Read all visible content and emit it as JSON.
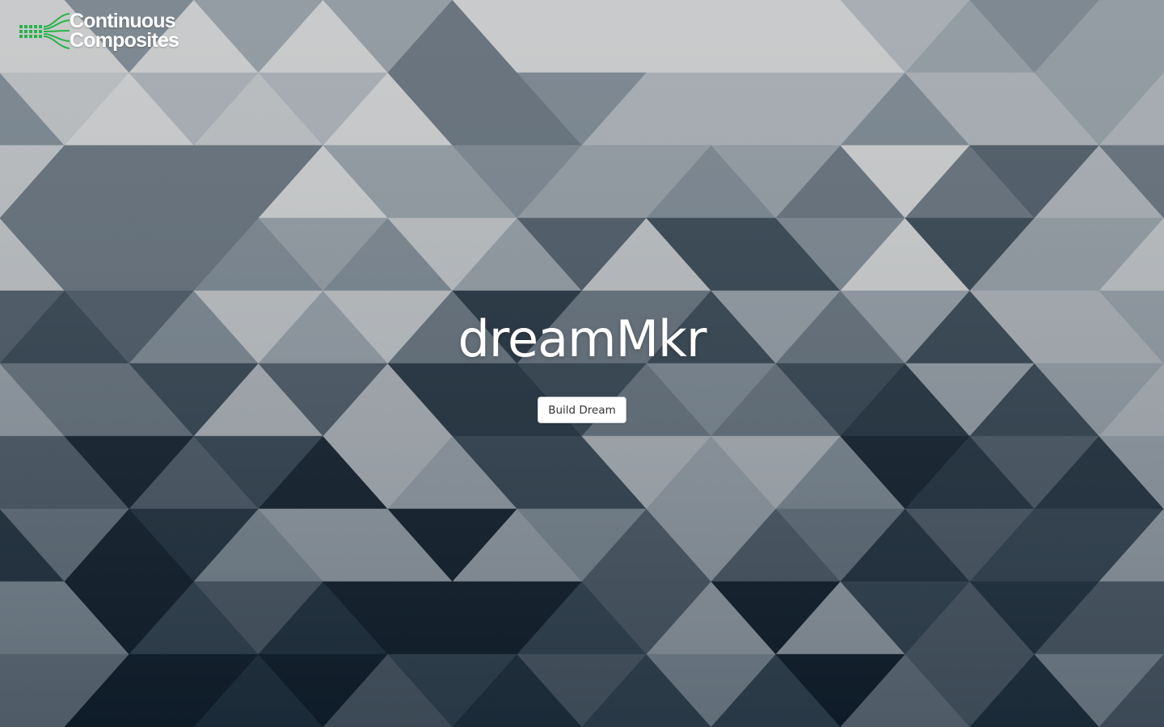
{
  "brand": {
    "line1": "Continuous",
    "line2": "Composites",
    "accent_color": "#27b34a"
  },
  "hero": {
    "title": "dreamMkr",
    "button_label": "Build Dream"
  },
  "theme": {
    "background_palette": [
      "#0f1c28",
      "#1e2d3a",
      "#2f3e4b",
      "#46535f",
      "#5d6974",
      "#737f89",
      "#8b949c",
      "#a1a7ad",
      "#b4b8bb",
      "#c4c6c7"
    ]
  }
}
